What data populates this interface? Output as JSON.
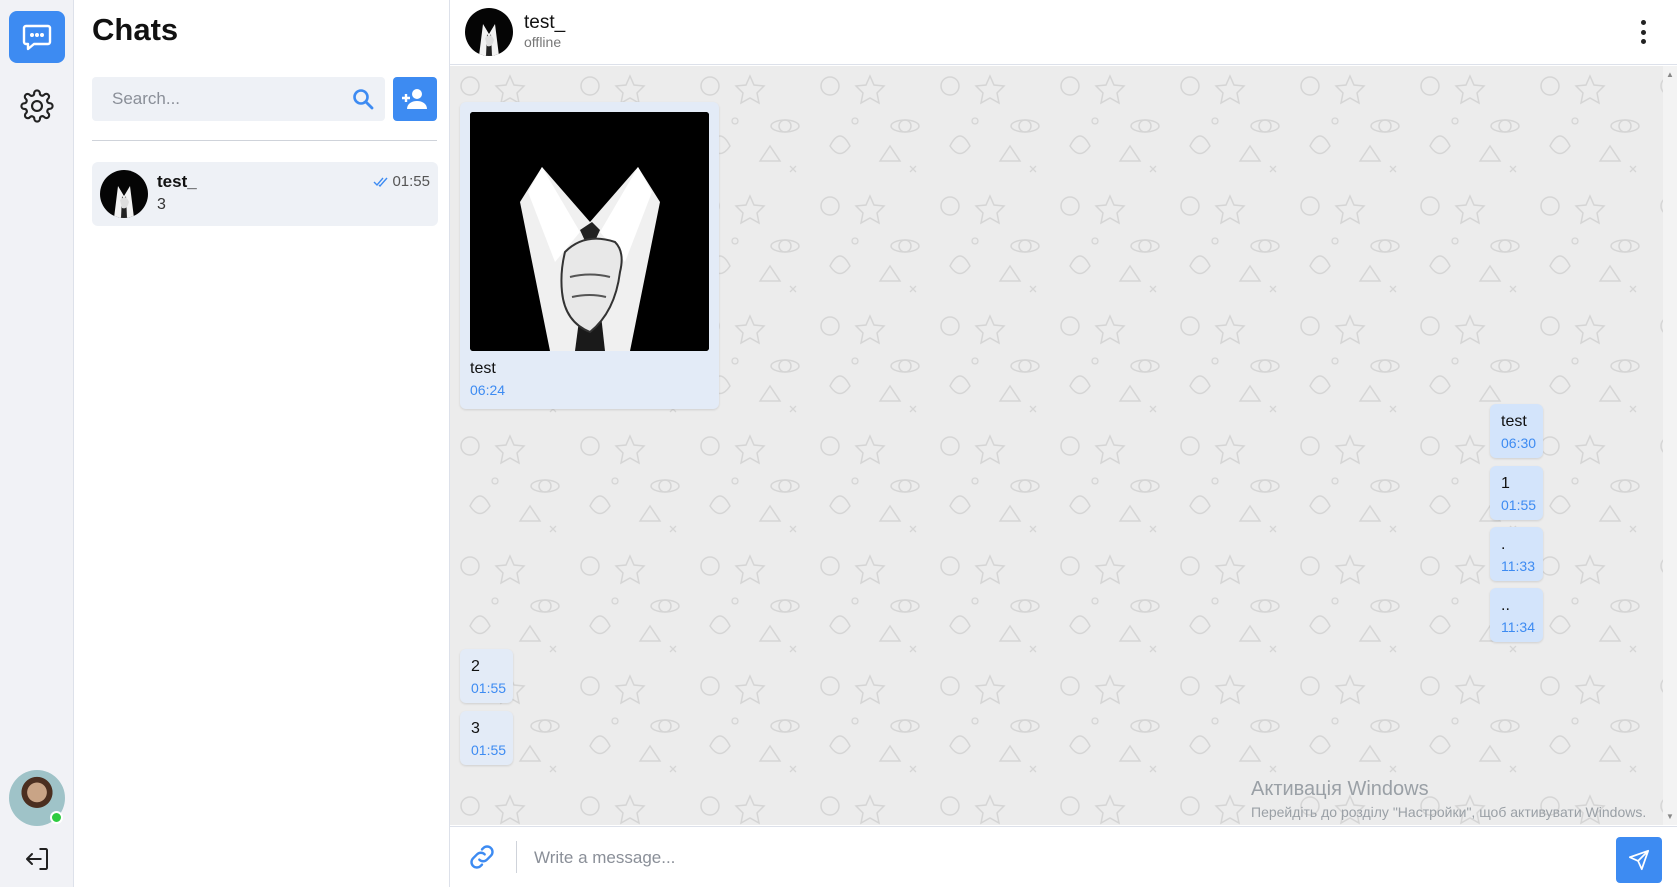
{
  "app": {
    "accent_color": "#3d8bf2",
    "online_color": "#2ecc40"
  },
  "rail": {
    "chat_icon": "chat-bubble-icon",
    "settings_icon": "gear-icon",
    "logout_icon": "logout-icon",
    "user_status": "online"
  },
  "sidebar": {
    "title": "Chats",
    "search": {
      "placeholder": "Search...",
      "value": ""
    },
    "search_icon": "search-icon",
    "add_contact_icon": "add-user-icon",
    "chats": [
      {
        "name": "test_",
        "last_message": "3",
        "time": "01:55",
        "read_icon": "double-check-icon"
      }
    ]
  },
  "conversation": {
    "contact_name": "test_",
    "contact_status": "offline",
    "menu_icon": "more-vertical-icon",
    "messages": [
      {
        "side": "left",
        "has_image": true,
        "text": "test",
        "time": "06:24"
      },
      {
        "side": "right",
        "text": "test",
        "time": "06:30"
      },
      {
        "side": "right",
        "text": "1",
        "time": "01:55"
      },
      {
        "side": "right",
        "text": ".",
        "time": "11:33"
      },
      {
        "side": "right",
        "text": "..",
        "time": "11:34"
      },
      {
        "side": "left",
        "text": "2",
        "time": "01:55"
      },
      {
        "side": "left",
        "text": "3",
        "time": "01:55"
      }
    ]
  },
  "composer": {
    "placeholder": "Write a message...",
    "value": "",
    "attach_icon": "link-icon",
    "send_icon": "send-icon"
  },
  "watermark": {
    "title": "Активація Windows",
    "subtitle": "Перейдіть до розділу \"Настройки\", щоб активувати Windows."
  }
}
